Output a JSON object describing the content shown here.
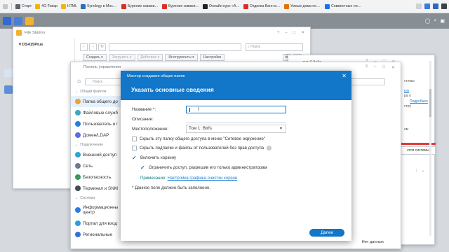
{
  "browser": {
    "bookmarks": [
      {
        "label": "Старт",
        "color": "#5f6368"
      },
      {
        "label": "4G-Товар",
        "color": "#f4b400"
      },
      {
        "label": "HTML",
        "color": "#f4b400"
      },
      {
        "label": "Synology в Москве...",
        "color": "#2d6fb8"
      },
      {
        "label": "Бурение скважин н...",
        "color": "#d93025"
      },
      {
        "label": "Бурение скважин н...",
        "color": "#d93025"
      },
      {
        "label": "Онлайн-курс «Ана...",
        "color": "#202124"
      },
      {
        "label": "Отделка Ванн внут...",
        "color": "#d93025"
      },
      {
        "label": "Умные дома под к...",
        "color": "#e37400"
      },
      {
        "label": "Совместные линзы",
        "color": "#1a73e8"
      }
    ]
  },
  "file_station": {
    "title": "File Station",
    "device": "DS415Plus",
    "search_placeholder": "Поиск",
    "toolbar": [
      "Создать",
      "Загрузить",
      "Действие",
      "Инструменты",
      "Настройки"
    ]
  },
  "right_panel": {
    "size_text": "дня: 0 Байт",
    "line1": "стемы",
    "link1": "гих",
    "line2": "ра о",
    "link2": "Подробнее",
    "line3": "стру",
    "line4": "ом",
    "button": "ктоп системы"
  },
  "control_panel": {
    "title": "Панель управления",
    "search_placeholder": "Поиск",
    "footer": "Нет данных",
    "groups": [
      {
        "label": "Общий файлов",
        "items": [
          {
            "label": "Папка общего до",
            "color": "#e8a33d",
            "selected": true
          },
          {
            "label": "Файловые служб",
            "color": "#3aa8c1"
          },
          {
            "label": "Пользователь и г",
            "color": "#2c7be5"
          },
          {
            "label": "Домен/LDAP",
            "color": "#5b6ee1"
          }
        ]
      },
      {
        "label": "Подключение",
        "items": [
          {
            "label": "Внешний доступ",
            "color": "#2fa4d7"
          },
          {
            "label": "Сеть",
            "color": "#6c7a89"
          },
          {
            "label": "Безопасность",
            "color": "#3b9a57"
          },
          {
            "label": "Терминал и SNM",
            "color": "#444b54"
          }
        ]
      },
      {
        "label": "Система",
        "items": [
          {
            "label": "Информационны центр",
            "color": "#2c7be5"
          },
          {
            "label": "Портал для вход",
            "color": "#29a0d8"
          },
          {
            "label": "Региональные",
            "color": "#3a6fd8"
          }
        ]
      }
    ]
  },
  "wizard": {
    "window_title": "Мастер создания общих папок",
    "heading": "Указать основные сведения",
    "name_label": "Название *:",
    "name_value": "",
    "description_label": "Описание:",
    "location_label": "Местоположение:",
    "location_value": "Том 1:  Btrfs",
    "hide_network": "Скрыть эту папку общего доступа в меню \"Сетевое окружение\"",
    "hide_files": "Скрыть подпапки и файлы от пользователей без прав доступа",
    "enable_recycle": "Включить корзину",
    "restrict_admin": "Ограничить доступ, разрешив его только администраторам",
    "note_label": "Примечание:",
    "note_link": "Настройка графика очистки корзин",
    "required_note": "* Данное поле должно быть заполнено.",
    "next_button": "Далее"
  }
}
